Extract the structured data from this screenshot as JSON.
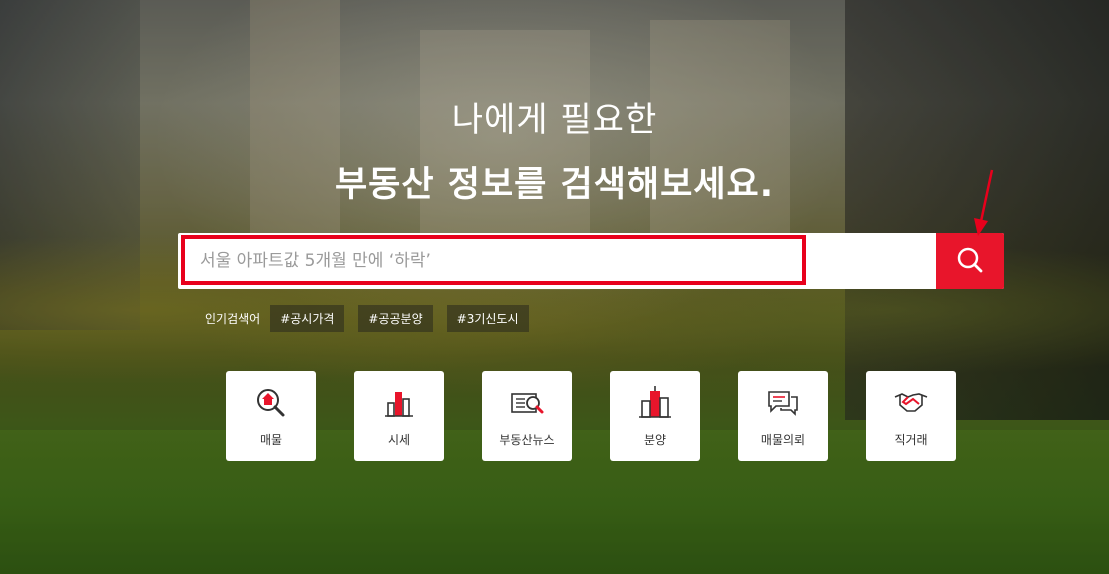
{
  "hero": {
    "title_line1": "나에게 필요한",
    "title_line2": "부동산 정보를 검색해보세요."
  },
  "search": {
    "placeholder": "서울 아파트값 5개월 만에 ‘하락’",
    "button_icon": "search-icon"
  },
  "popular": {
    "label": "인기검색어",
    "tags": [
      "#공시가격",
      "#공공분양",
      "#3기신도시"
    ]
  },
  "categories": [
    {
      "label": "매물",
      "icon": "house-search-icon"
    },
    {
      "label": "시세",
      "icon": "bar-chart-icon"
    },
    {
      "label": "부동산뉴스",
      "icon": "newspaper-search-icon"
    },
    {
      "label": "분양",
      "icon": "building-icon"
    },
    {
      "label": "매물의뢰",
      "icon": "chat-bubbles-icon"
    },
    {
      "label": "직거래",
      "icon": "handshake-icon"
    }
  ],
  "colors": {
    "accent": "#e8152b",
    "highlight": "#e8001c"
  }
}
